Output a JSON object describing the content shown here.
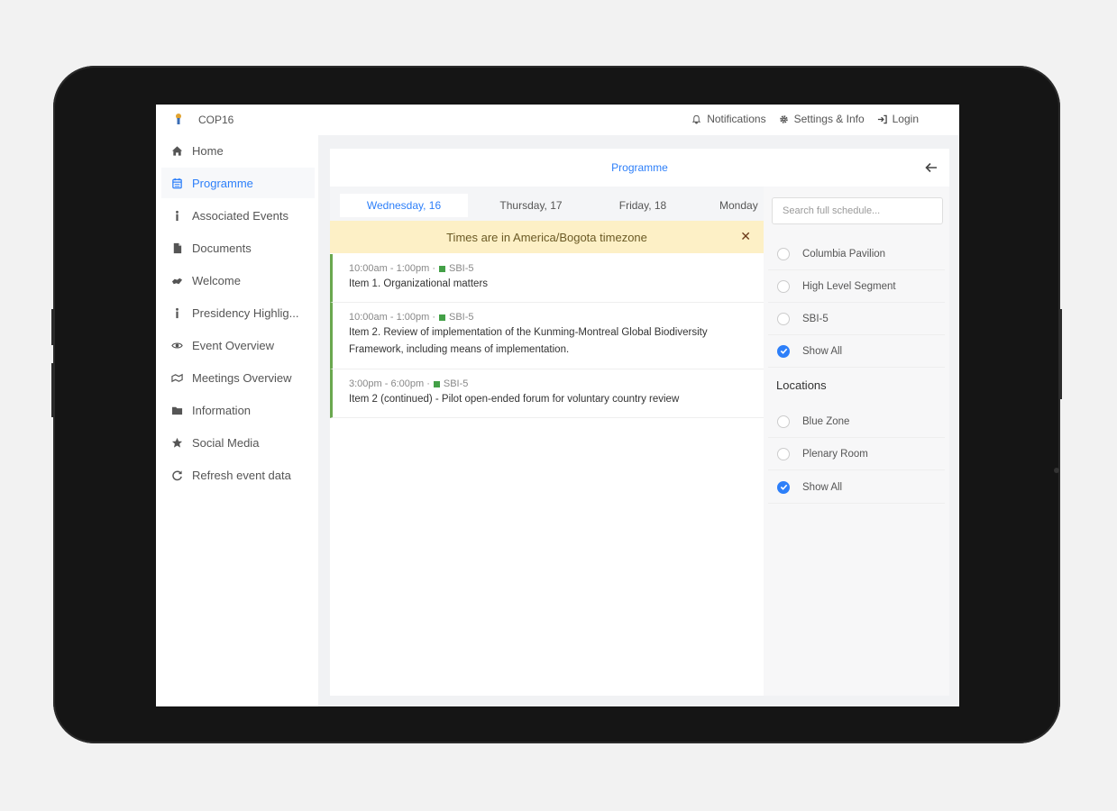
{
  "app": {
    "name": "COP16"
  },
  "topbar": {
    "notifications_label": "Notifications",
    "settings_label": "Settings & Info",
    "login_label": "Login"
  },
  "sidebar": {
    "items": [
      {
        "label": "Home",
        "icon": "home-icon"
      },
      {
        "label": "Programme",
        "icon": "calendar-icon",
        "active": true
      },
      {
        "label": "Associated Events",
        "icon": "info-icon"
      },
      {
        "label": "Documents",
        "icon": "document-icon"
      },
      {
        "label": "Welcome",
        "icon": "handshake-icon"
      },
      {
        "label": "Presidency Highlig...",
        "icon": "info-icon"
      },
      {
        "label": "Event Overview",
        "icon": "eye-icon"
      },
      {
        "label": "Meetings Overview",
        "icon": "meetings-icon"
      },
      {
        "label": "Information",
        "icon": "folder-icon"
      },
      {
        "label": "Social Media",
        "icon": "star-icon"
      },
      {
        "label": "Refresh event data",
        "icon": "refresh-icon"
      }
    ]
  },
  "panel": {
    "title": "Programme",
    "tabs": [
      {
        "label": "Wednesday, 16",
        "active": true
      },
      {
        "label": "Thursday, 17"
      },
      {
        "label": "Friday, 18"
      },
      {
        "label": "Monday"
      }
    ],
    "timezone_banner": "Times are in America/Bogota timezone",
    "events": [
      {
        "time": "10:00am - 1:00pm ·",
        "tag": "SBI-5",
        "title": "Item 1. Organizational matters"
      },
      {
        "time": "10:00am - 1:00pm ·",
        "tag": "SBI-5",
        "title": "Item 2. Review of implementation of the Kunming-Montreal Global Biodiversity Framework, including means of implementation."
      },
      {
        "time": "3:00pm - 6:00pm ·",
        "tag": "SBI-5",
        "title": "Item 2 (continued) - Pilot open-ended forum for voluntary country review"
      }
    ]
  },
  "filters": {
    "search_placeholder": "Search full schedule...",
    "tracks": [
      {
        "label": "Columbia Pavilion",
        "checked": false
      },
      {
        "label": "High Level Segment",
        "checked": false
      },
      {
        "label": "SBI-5",
        "checked": false
      },
      {
        "label": "Show All",
        "checked": true
      }
    ],
    "locations_heading": "Locations",
    "locations": [
      {
        "label": "Blue Zone",
        "checked": false
      },
      {
        "label": "Plenary Room",
        "checked": false
      },
      {
        "label": "Show All",
        "checked": true
      }
    ]
  },
  "colors": {
    "accent": "#2d7ff9",
    "event_border": "#6aa84f",
    "banner_bg": "#fdf0c6"
  }
}
